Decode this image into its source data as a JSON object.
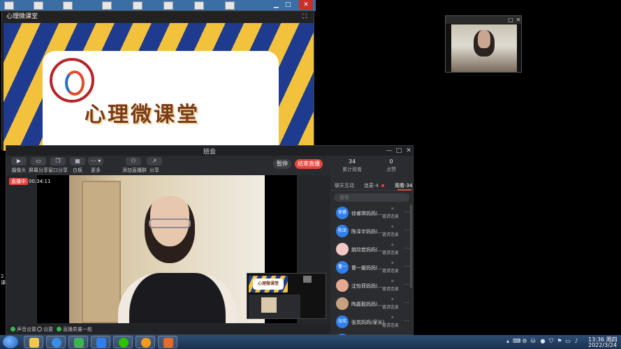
{
  "slide_window": {
    "title": "心理微课堂",
    "slide_heading": "心理微课堂"
  },
  "meeting": {
    "title": "班会",
    "toolbar": [
      {
        "label": "摄像头",
        "icon": "camera-icon"
      },
      {
        "label": "屏幕分享",
        "icon": "screen-share-icon"
      },
      {
        "label": "窗口分享",
        "icon": "window-share-icon"
      },
      {
        "label": "白板",
        "icon": "whiteboard-icon"
      },
      {
        "label": "更多",
        "icon": "more-icon"
      },
      {
        "label": "添加直播群",
        "icon": "add-group-icon"
      },
      {
        "label": "分享",
        "icon": "share-icon"
      }
    ],
    "pause_label": "暂停",
    "end_label": "结束直播",
    "live_badge": "直播中",
    "live_timer": "00:34:11",
    "pip_slide_text": "心理微课堂"
  },
  "panel": {
    "stats": [
      {
        "value": "34",
        "label": "累计观看"
      },
      {
        "value": "0",
        "label": "点赞"
      }
    ],
    "tabs": [
      {
        "label": "聊天互动"
      },
      {
        "label": "连麦-4"
      },
      {
        "label": "观看-34"
      }
    ],
    "search_placeholder": "搜索",
    "invite_label": "邀请连麦",
    "audience": [
      {
        "avatar": "徐睿",
        "name": "徐睿琪妈妈(..."
      },
      {
        "avatar": "陈泽",
        "name": "陈泽宇妈妈(..."
      },
      {
        "avatar": "",
        "name": "姚欣若妈妈(..."
      },
      {
        "avatar": "曹一",
        "name": "曹一媛妈妈(..."
      },
      {
        "avatar": "",
        "name": "沈怡菲妈妈(..."
      },
      {
        "avatar": "",
        "name": "陶嘉毅妈妈(..."
      },
      {
        "avatar": "张岚",
        "name": "张岚妈妈(家长)"
      }
    ]
  },
  "status_bar": {
    "audio_settings": "声音设置",
    "settings": "设置",
    "quality": "直播质量一般"
  },
  "edge_text": "2\n课",
  "taskbar": {
    "time": "13:36 周四",
    "date": "2022/3/24"
  },
  "colors": {
    "accent_red": "#e8443b",
    "avatar_blue": "#2f80ed",
    "panel_bg": "#2b2c30"
  }
}
